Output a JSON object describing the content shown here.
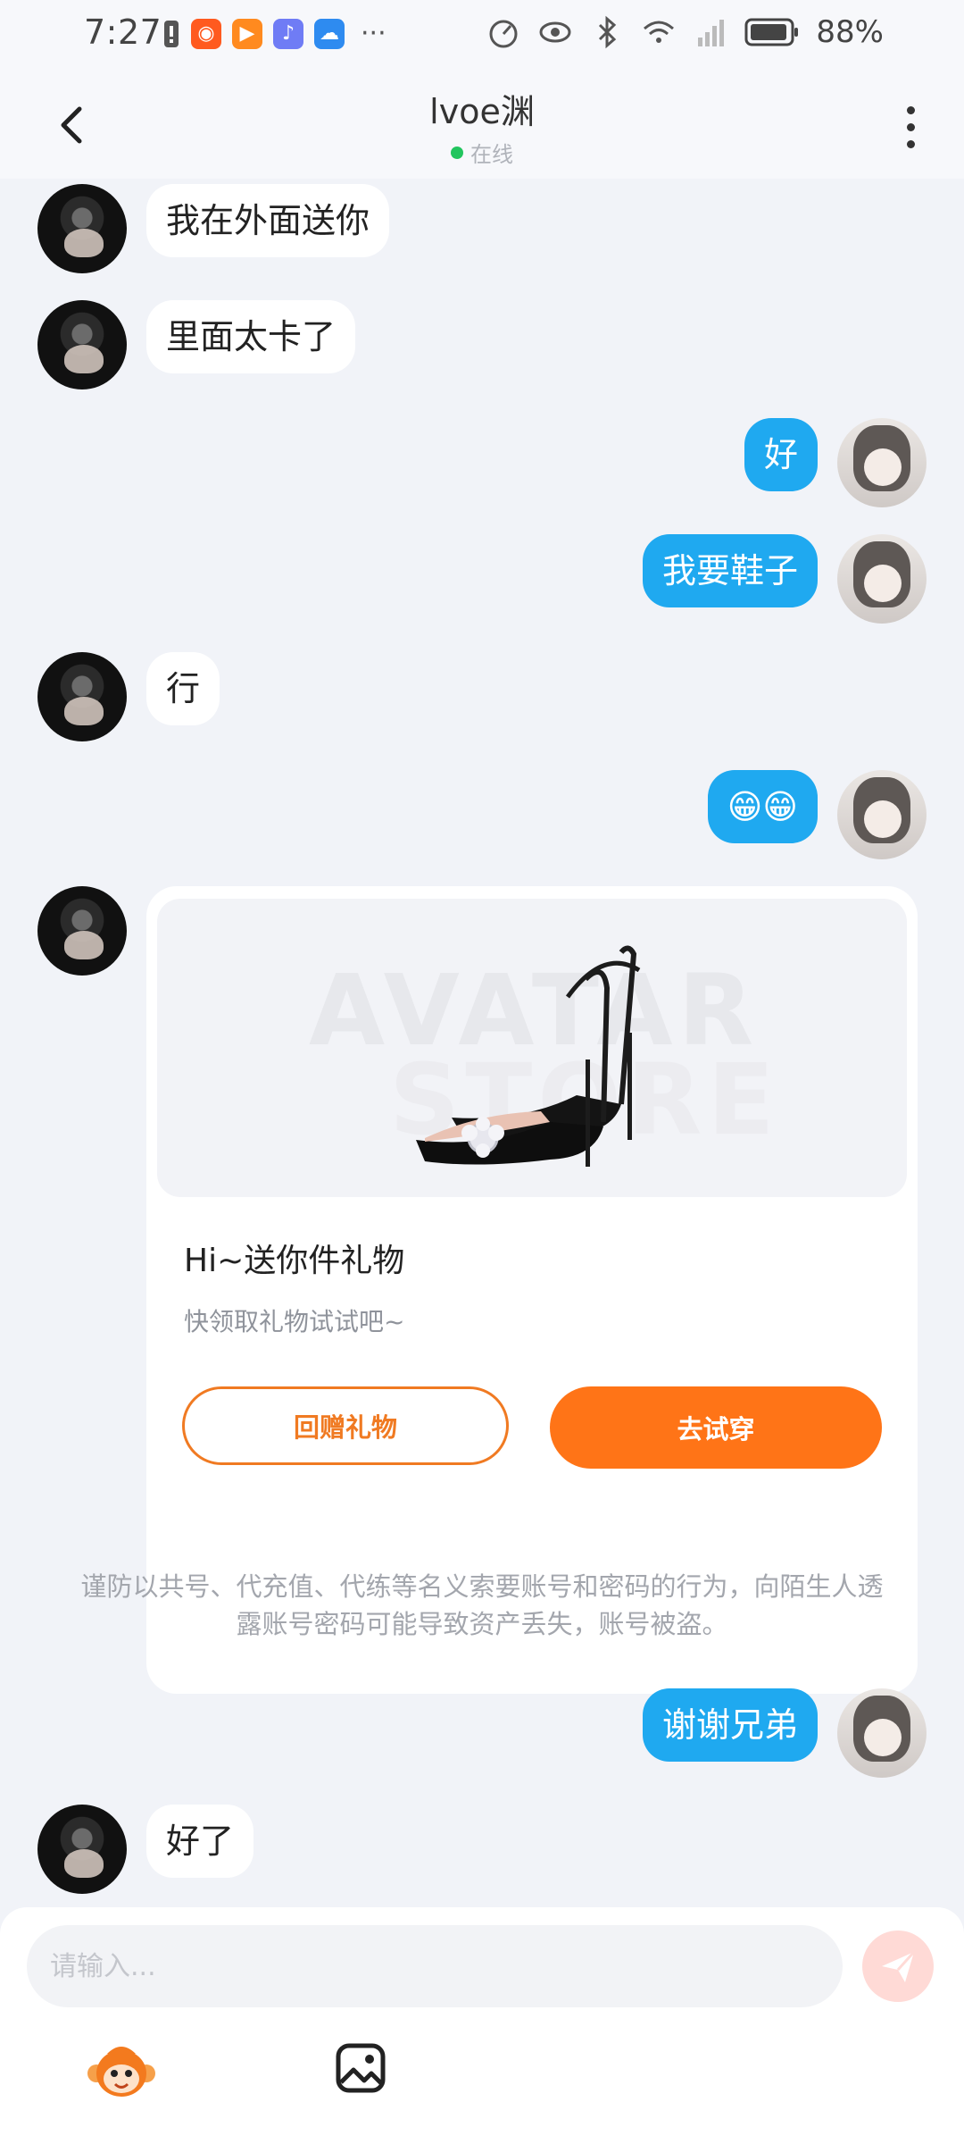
{
  "status_bar": {
    "time": "7:27",
    "battery": "88%",
    "overflow": "···"
  },
  "header": {
    "name": "lvoe渊",
    "status": "在线"
  },
  "messages": [
    {
      "side": "in",
      "text": "我在外面送你"
    },
    {
      "side": "in",
      "text": "里面太卡了"
    },
    {
      "side": "out",
      "text": "好"
    },
    {
      "side": "out",
      "text": "我要鞋子"
    },
    {
      "side": "in",
      "text": "行"
    },
    {
      "side": "out",
      "text": "😁😁"
    },
    {
      "side": "out",
      "text": "谢谢兄弟"
    },
    {
      "side": "in",
      "text": "好了"
    }
  ],
  "gift_card": {
    "watermark_line1": "AVATAR",
    "watermark_line2": "STORE",
    "title": "Hi~送你件礼物",
    "subtitle": "快领取礼物试试吧~",
    "return_button": "回赠礼物",
    "try_button": "去试穿"
  },
  "warning": "谨防以共号、代充值、代练等名义索要账号和密码的行为，向陌生人透露账号密码可能导致资产丢失，账号被盗。",
  "composer": {
    "placeholder": "请输入..."
  },
  "colors": {
    "outgoing_bubble": "#1fa9f0",
    "accent_orange": "#ff7417",
    "online": "#22c55e"
  }
}
